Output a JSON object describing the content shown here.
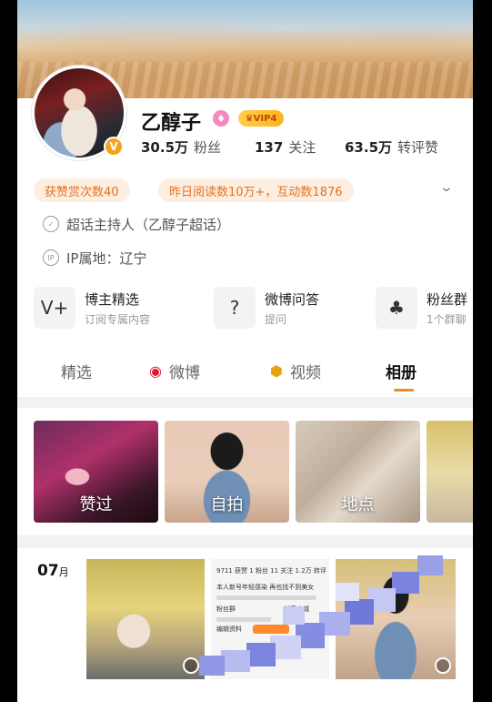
{
  "profile": {
    "name": "乙醇子",
    "vip": "VIP4",
    "verified_badge": "V",
    "stats": [
      {
        "num": "30.5万",
        "label": "粉丝"
      },
      {
        "num": "137",
        "label": "关注"
      },
      {
        "num": "63.5万",
        "label": "转评赞"
      }
    ],
    "pills": [
      "获赞赏次数40",
      "昨日阅读数10万+，互动数1876"
    ],
    "host": "超话主持人（乙醇子超话）",
    "ip": "IP属地：辽宁",
    "ip_icon": "IP"
  },
  "features": [
    {
      "icon": "V+",
      "title": "博主精选",
      "sub": "订阅专属内容"
    },
    {
      "icon": "?",
      "title": "微博问答",
      "sub": "提问"
    },
    {
      "icon": "♣",
      "title": "粉丝群",
      "sub": "1个群聊"
    }
  ],
  "tabs": [
    {
      "label": "精选"
    },
    {
      "label": "微博"
    },
    {
      "label": "视频"
    },
    {
      "label": "相册"
    }
  ],
  "albums": [
    "赞过",
    "自拍",
    "地点"
  ],
  "month": {
    "num": "07",
    "unit": "月"
  },
  "screenshot_text": {
    "stats": "9711 获赞 1 粉丝 11 关注 1.2万 转评",
    "line1": "本人新号年轻感染 再也找不到美女",
    "shop": "粉丝群",
    "fans": "抖音商城",
    "btn": "编辑资料"
  }
}
